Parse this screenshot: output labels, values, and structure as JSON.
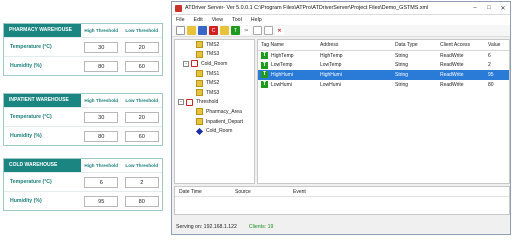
{
  "warehouses": [
    {
      "name": "PHARMACY WAREHOUSE",
      "high_label": "High Threshold",
      "low_label": "Low Threshold",
      "rows": [
        {
          "label": "Temperature (°C)",
          "high": "30",
          "low": "20"
        },
        {
          "label": "Humidity (%)",
          "high": "80",
          "low": "60"
        }
      ]
    },
    {
      "name": "INPATIENT WAREHOUSE",
      "high_label": "High Threshold",
      "low_label": "Low Threshold",
      "rows": [
        {
          "label": "Temperature (°C)",
          "high": "30",
          "low": "20"
        },
        {
          "label": "Humidity (%)",
          "high": "80",
          "low": "60"
        }
      ]
    },
    {
      "name": "COLD WAREHOUSE",
      "high_label": "High Threshold",
      "low_label": "Low Threshold",
      "rows": [
        {
          "label": "Temperature (°C)",
          "high": "6",
          "low": "2"
        },
        {
          "label": "Humidity (%)",
          "high": "95",
          "low": "80"
        }
      ]
    }
  ],
  "window": {
    "title": "ATDriver Server- Ver 5.0.0.1     C:\\Program Files\\ATPro\\ATDriverServer\\Project Files\\Demo_GSTMS.xml",
    "menu": [
      "File",
      "Edit",
      "View",
      "Tool",
      "Help"
    ],
    "tree": [
      {
        "label": "TMS2",
        "indent": 2,
        "icon": "folder"
      },
      {
        "label": "TMS3",
        "indent": 2,
        "icon": "folder"
      },
      {
        "label": "Cold_Room",
        "indent": 1,
        "icon": "channel",
        "expander": "-"
      },
      {
        "label": "TMS1",
        "indent": 2,
        "icon": "folder"
      },
      {
        "label": "TMS2",
        "indent": 2,
        "icon": "folder"
      },
      {
        "label": "TMS3",
        "indent": 2,
        "icon": "folder"
      },
      {
        "label": "Threshold",
        "indent": 0,
        "icon": "channel",
        "expander": "-"
      },
      {
        "label": "Pharmacy_Area",
        "indent": 2,
        "icon": "folder"
      },
      {
        "label": "Inpatient_Depart",
        "indent": 2,
        "icon": "folder"
      },
      {
        "label": "Cold_Room",
        "indent": 2,
        "icon": "diamond"
      }
    ],
    "columns": [
      "Tag Name",
      "Address",
      "Data Type",
      "Client Access",
      "Value"
    ],
    "rows": [
      {
        "tag": "HighTemp",
        "address": "HighTemp",
        "type": "String",
        "access": "ReadWrite",
        "value": "6",
        "selected": false
      },
      {
        "tag": "LowTemp",
        "address": "LowTemp",
        "type": "String",
        "access": "ReadWrite",
        "value": "2",
        "selected": false
      },
      {
        "tag": "HighHumi",
        "address": "HighHumi",
        "type": "String",
        "access": "ReadWrite",
        "value": "95",
        "selected": true
      },
      {
        "tag": "LowHumi",
        "address": "LowHumi",
        "type": "String",
        "access": "ReadWrite",
        "value": "80",
        "selected": false
      }
    ],
    "log_columns": [
      "Date Time",
      "Source",
      "Event"
    ],
    "status": {
      "serving": "Serving on: 192.168.1.122",
      "clients": "Clients: 19"
    }
  },
  "colors": {
    "accent": "#1b8581",
    "selection": "#2a7ad8",
    "folder": "#e8c23a",
    "channel": "#d12222",
    "tag": "#1f9a1f"
  }
}
